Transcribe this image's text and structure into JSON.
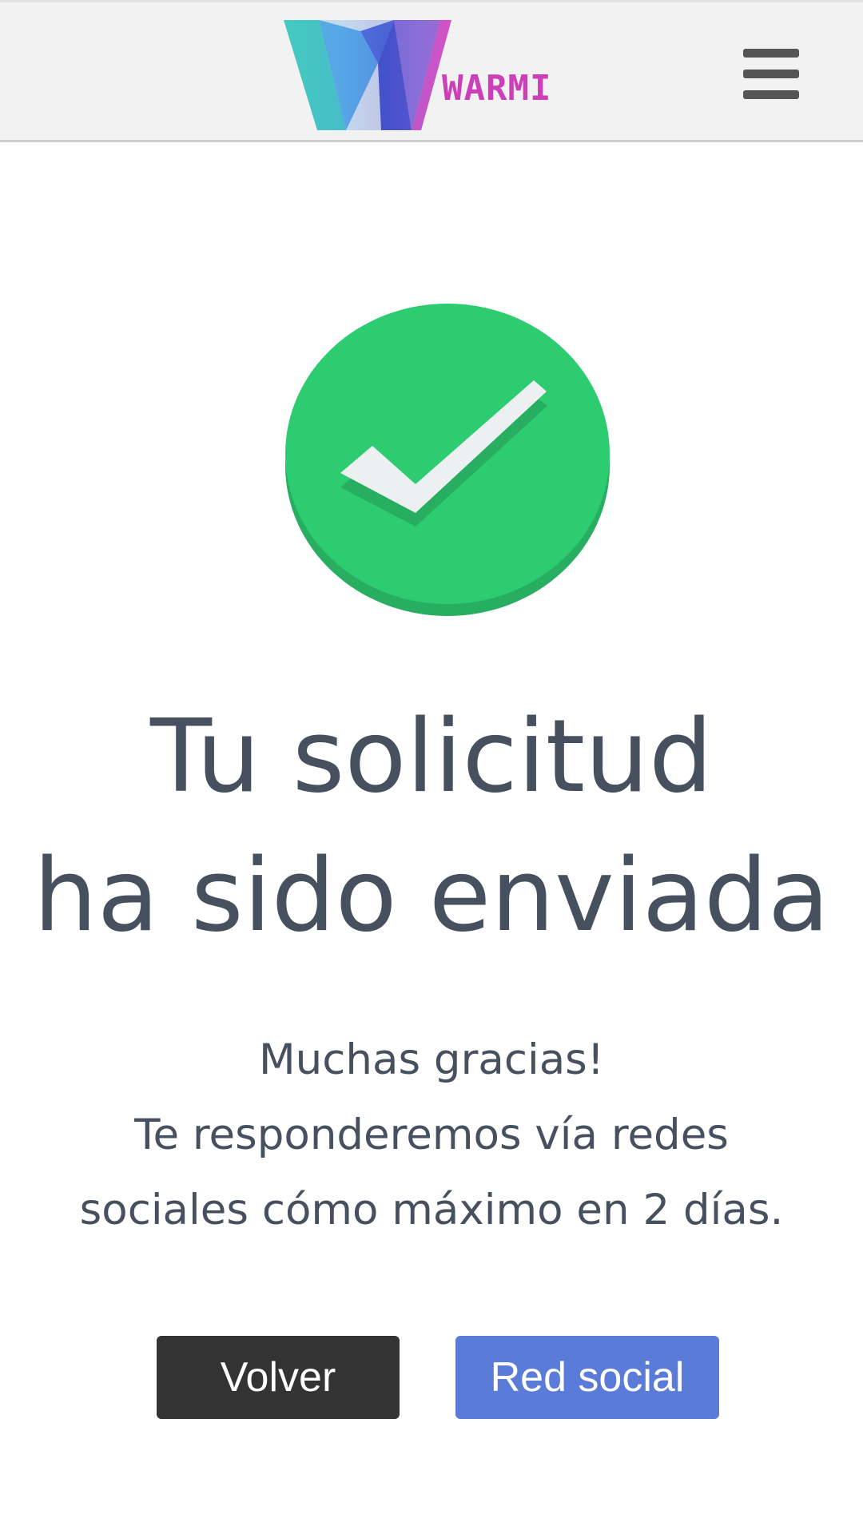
{
  "header": {
    "logo_text": "WARMI",
    "logo_icon": "warmi-w-logo",
    "menu_icon": "hamburger-menu-icon"
  },
  "status_icon": "check-circle-icon",
  "colors": {
    "success_green": "#2ecc71",
    "success_green_shadow": "#27ae60",
    "check_white": "#ecf0f1",
    "text": "#46505e",
    "back_button": "#333333",
    "social_button": "#5b7bd8",
    "logo_pink": "#cc3fb8"
  },
  "main": {
    "title_line1": "Tu solicitud",
    "title_line2": "ha sido enviada",
    "message_line1": "Muchas gracias!",
    "message_line2": "Te responderemos vía redes",
    "message_line3": "sociales cómo máximo en 2 días."
  },
  "actions": {
    "back_label": "Volver",
    "social_label": "Red social"
  }
}
